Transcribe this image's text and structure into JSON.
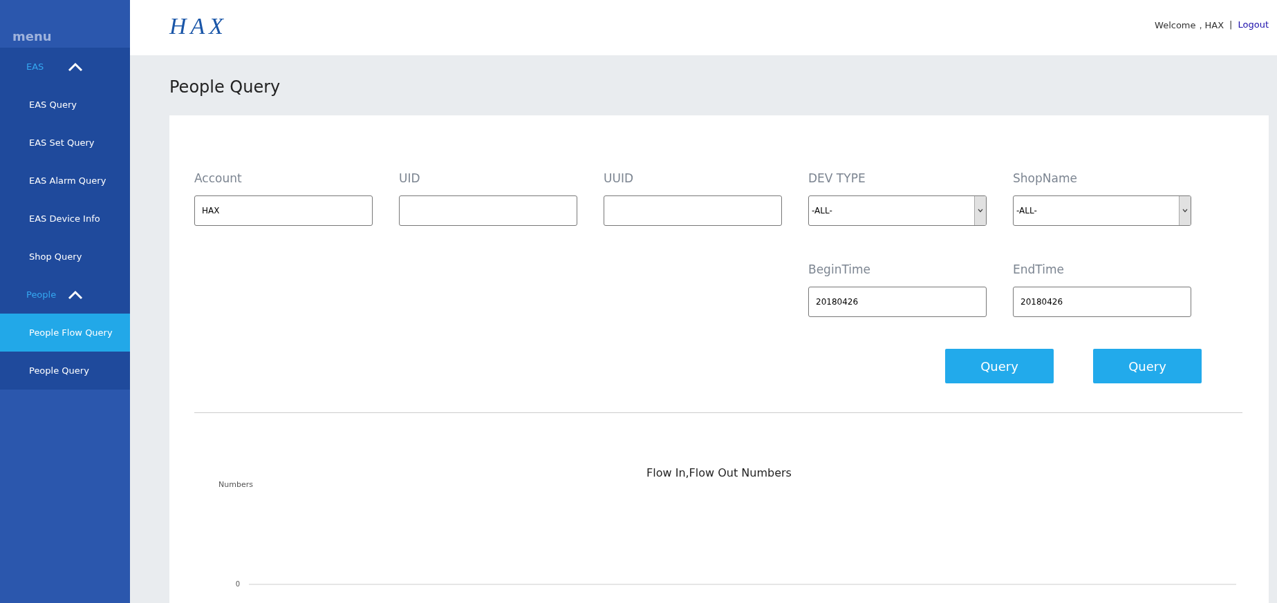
{
  "sidebar": {
    "title": "menu",
    "groups": [
      {
        "label": "EAS",
        "expanded": true,
        "children": [
          {
            "label": "EAS Query",
            "selected": false
          },
          {
            "label": "EAS Set Query",
            "selected": false
          },
          {
            "label": "EAS Alarm Query",
            "selected": false
          },
          {
            "label": "EAS Device Info",
            "selected": false
          },
          {
            "label": "Shop Query",
            "selected": false
          }
        ]
      },
      {
        "label": "People",
        "expanded": true,
        "children": [
          {
            "label": "People Flow Query",
            "selected": true
          },
          {
            "label": "People Query",
            "selected": false
          }
        ]
      }
    ]
  },
  "header": {
    "logo": "HAX",
    "welcome": "Welcome，HAX",
    "separator": "|",
    "logout": "Logout"
  },
  "page_title": "People Query",
  "field_rows": [
    [
      {
        "kind": "text",
        "label": "Account",
        "value": "HAX"
      },
      {
        "kind": "text",
        "label": "UID"
      },
      {
        "kind": "text",
        "label": "UUID"
      },
      {
        "kind": "select",
        "label": "DEV TYPE",
        "value": "-ALL-"
      },
      {
        "kind": "select",
        "label": "ShopName",
        "value": "-ALL-"
      }
    ],
    [
      {
        "kind": "text",
        "label": "BeginTime",
        "value": "20180426"
      },
      {
        "kind": "text",
        "label": "EndTime",
        "value": "20180426"
      }
    ]
  ],
  "buttons": [
    "Query",
    "Query"
  ],
  "chart": {
    "kind": "line",
    "title": "Flow In,Flow Out Numbers",
    "axis_label": "Numbers",
    "tick_label": "0"
  }
}
